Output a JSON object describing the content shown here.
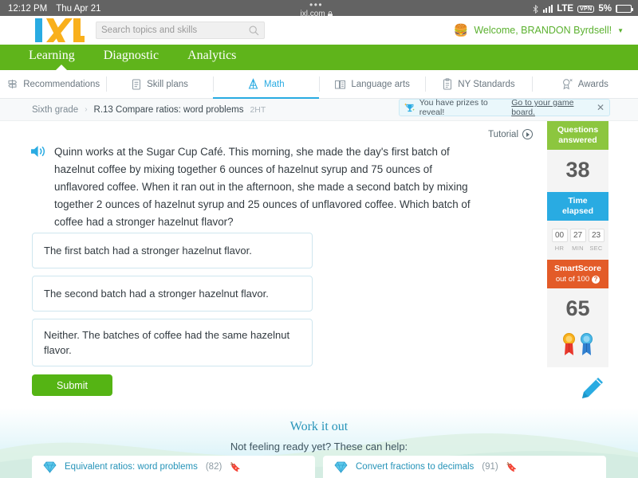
{
  "status_bar": {
    "time": "12:12 PM",
    "date": "Thu Apr 21",
    "dots": "•••",
    "url": "ixl.com",
    "lock_icon": "lock-icon",
    "network": "LTE",
    "vpn": "VPN",
    "battery_percent": "5%"
  },
  "header": {
    "logo_text": "IXL",
    "search_placeholder": "Search topics and skills",
    "search_icon": "search-icon",
    "avatar_icon": "hamburger-avatar-icon",
    "welcome_text": "Welcome, BRANDON Byrdsell!",
    "caret_icon": "chevron-down-icon"
  },
  "main_nav": {
    "items": [
      {
        "label": "Learning",
        "active": true
      },
      {
        "label": "Diagnostic",
        "active": false
      },
      {
        "label": "Analytics",
        "active": false
      }
    ]
  },
  "tabs": [
    {
      "label": "Recommendations",
      "icon": "signpost-icon",
      "active": false
    },
    {
      "label": "Skill plans",
      "icon": "clipboard-list-icon",
      "active": false
    },
    {
      "label": "Math",
      "icon": "compass-icon",
      "active": true
    },
    {
      "label": "Language arts",
      "icon": "open-book-icon",
      "active": false
    },
    {
      "label": "NY Standards",
      "icon": "clipboard-icon",
      "active": false
    },
    {
      "label": "Awards",
      "icon": "ribbon-award-icon",
      "active": false
    }
  ],
  "breadcrumb": {
    "grade": "Sixth grade",
    "separator": "›",
    "skill": "R.13 Compare ratios: word problems",
    "code": "2HT"
  },
  "prize_toast": {
    "icon": "trophy-icon",
    "text": "You have prizes to reveal!",
    "link": "Go to your game board.",
    "close_icon": "close-icon"
  },
  "question": {
    "tutorial_label": "Tutorial",
    "tutorial_icon": "play-circle-icon",
    "speaker_icon": "speaker-icon",
    "text": "Quinn works at the Sugar Cup Café. This morning, she made the day's first batch of hazelnut coffee by mixing together 6 ounces of hazelnut syrup and 75 ounces of unflavored coffee. When it ran out in the afternoon, she made a second batch by mixing together 2 ounces of hazelnut syrup and 25 ounces of unflavored coffee. Which batch of coffee had a stronger hazelnut flavor?",
    "choices": [
      "The first batch had a stronger hazelnut flavor.",
      "The second batch had a stronger hazelnut flavor.",
      "Neither. The batches of coffee had the same hazelnut flavor."
    ],
    "submit_label": "Submit",
    "pencil_icon": "pencil-icon"
  },
  "rail": {
    "questions_answered": {
      "title_line1": "Questions",
      "title_line2": "answered",
      "value": "38",
      "color": "#8cc63f"
    },
    "time_elapsed": {
      "title_line1": "Time",
      "title_line2": "elapsed",
      "color": "#29abe2",
      "hours": "00",
      "minutes": "27",
      "seconds": "23",
      "hr_label": "HR",
      "min_label": "MIN",
      "sec_label": "SEC"
    },
    "smartscore": {
      "title": "SmartScore",
      "subtitle": "out of 100",
      "help_icon": "question-mark-icon",
      "value": "65",
      "color": "#e35b28",
      "ribbons": [
        "gold-ribbon-icon",
        "blue-ribbon-icon"
      ]
    }
  },
  "work_it_out": {
    "title": "Work it out",
    "subtitle": "Not feeling ready yet? These can help:",
    "cards": [
      {
        "icon": "diamond-icon",
        "label": "Equivalent ratios: word problems",
        "count": "(82)",
        "bookmark_icon": "bookmark-icon"
      },
      {
        "icon": "diamond-icon",
        "label": "Convert fractions to decimals",
        "count": "(91)",
        "bookmark_icon": "bookmark-icon"
      }
    ]
  }
}
